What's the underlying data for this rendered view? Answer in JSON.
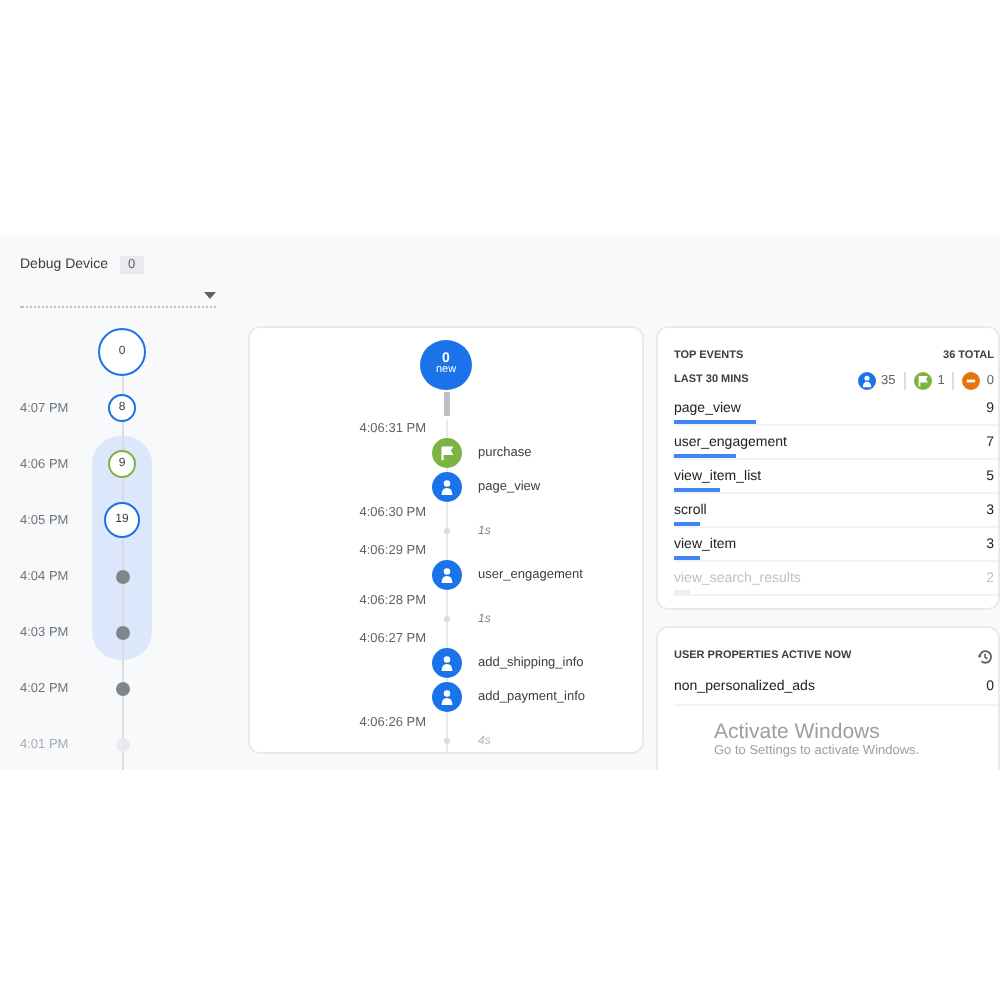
{
  "device": {
    "label": "Debug Device",
    "count": "0"
  },
  "minutes": [
    {
      "kind": "count",
      "count": "0",
      "color": "#1a73e8",
      "selected": false
    },
    {
      "time": "4:07 PM",
      "kind": "count",
      "count": "8",
      "color": "#1a73e8",
      "selected": false
    },
    {
      "time": "4:06 PM",
      "kind": "count",
      "count": "9",
      "color": "#7cb342",
      "selected": true
    },
    {
      "time": "4:05 PM",
      "kind": "count",
      "count": "19",
      "color": "#1a73e8",
      "selected": true
    },
    {
      "time": "4:04 PM",
      "kind": "dot",
      "selected": true
    },
    {
      "time": "4:03 PM",
      "kind": "dot",
      "selected": true
    },
    {
      "time": "4:02 PM",
      "kind": "dot",
      "selected": false
    },
    {
      "time": "4:01 PM",
      "kind": "fading",
      "selected": false
    }
  ],
  "stream": {
    "new_count": "0",
    "new_label": "new",
    "rows": [
      {
        "kind": "time",
        "text": "4:06:31 PM"
      },
      {
        "kind": "conversion",
        "text": "purchase"
      },
      {
        "kind": "event",
        "text": "page_view"
      },
      {
        "kind": "time",
        "text": "4:06:30 PM"
      },
      {
        "kind": "gap",
        "text": "1s",
        "faded": false
      },
      {
        "kind": "time",
        "text": "4:06:29 PM"
      },
      {
        "kind": "event",
        "text": "user_engagement"
      },
      {
        "kind": "time",
        "text": "4:06:28 PM"
      },
      {
        "kind": "gap",
        "text": "1s",
        "faded": false
      },
      {
        "kind": "time",
        "text": "4:06:27 PM"
      },
      {
        "kind": "event",
        "text": "add_shipping_info"
      },
      {
        "kind": "event",
        "text": "add_payment_info"
      },
      {
        "kind": "time",
        "text": "4:06:26 PM"
      },
      {
        "kind": "gap",
        "text": "4s",
        "faded": true
      }
    ]
  },
  "top_events": {
    "title": "TOP EVENTS",
    "total": "36 TOTAL",
    "period": "LAST 30 MINS",
    "counters": [
      {
        "value": "35",
        "color": "#1a73e8"
      },
      {
        "value": "1",
        "color": "#7cb342"
      },
      {
        "value": "0",
        "color": "#e8710a"
      }
    ],
    "rows": [
      {
        "name": "page_view",
        "count": "9",
        "level": 0.25,
        "faded": false
      },
      {
        "name": "user_engagement",
        "count": "7",
        "level": 0.19,
        "faded": false
      },
      {
        "name": "view_item_list",
        "count": "5",
        "level": 0.14,
        "faded": false
      },
      {
        "name": "scroll",
        "count": "3",
        "level": 0.08,
        "faded": false
      },
      {
        "name": "view_item",
        "count": "3",
        "level": 0.08,
        "faded": false
      },
      {
        "name": "view_search_results",
        "count": "2",
        "level": 0.05,
        "faded": true
      }
    ]
  },
  "user_properties": {
    "title": "USER PROPERTIES ACTIVE NOW",
    "rows": [
      {
        "name": "non_personalized_ads",
        "value": "0"
      }
    ]
  },
  "os_notice": {
    "title": "Activate Windows",
    "subtitle": "Go to Settings to activate Windows."
  }
}
